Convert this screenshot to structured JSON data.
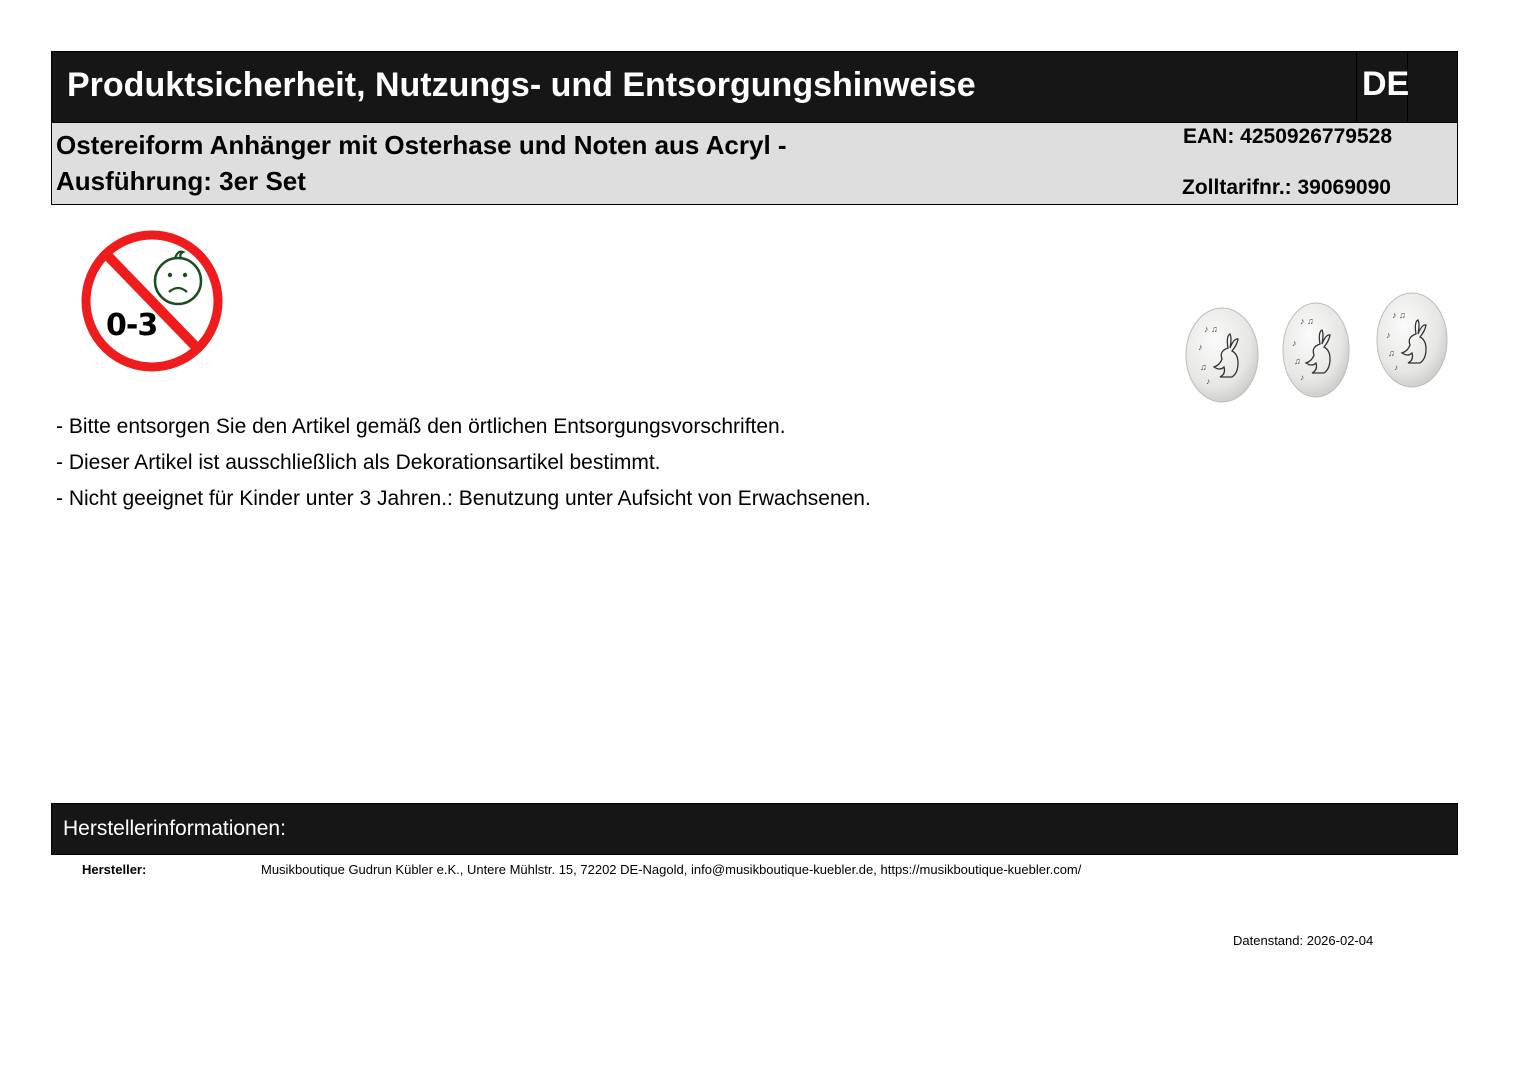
{
  "header": {
    "title": "Produktsicherheit, Nutzungs- und Entsorgungshinweise",
    "language": "DE"
  },
  "product": {
    "name": " Ostereiform Anhänger mit Osterhase und Noten aus Acryl -\nAusführung: 3er Set",
    "ean": "EAN: 4250926779528",
    "customs_tariff": "Zolltarifnr.: 39069090"
  },
  "warning": {
    "icon": "not-for-children-under-3-icon",
    "age_label": "0-3",
    "colors": {
      "ring": "#ee1c1c",
      "face": "#1d4d1d"
    }
  },
  "product_image": {
    "icon": "easter-egg-pendants-icon"
  },
  "notes": [
    "- Bitte entsorgen Sie den Artikel gemäß den örtlichen Entsorgungsvorschriften.",
    "- Dieser Artikel ist ausschließlich als Dekorationsartikel bestimmt.",
    "- Nicht geeignet für Kinder unter 3 Jahren.: Benutzung unter Aufsicht von Erwachsenen."
  ],
  "manufacturer": {
    "section_title": "Herstellerinformationen:",
    "label": "Hersteller:",
    "value": "Musikboutique Gudrun Kübler e.K., Untere Mühlstr. 15, 72202 DE-Nagold, info@musikboutique-kuebler.de, https://musikboutique-kuebler.com/"
  },
  "footer": {
    "date": "Datenstand: 2026-02-04"
  },
  "colors": {
    "header_bg": "#161616",
    "info_bg": "#dedede"
  }
}
